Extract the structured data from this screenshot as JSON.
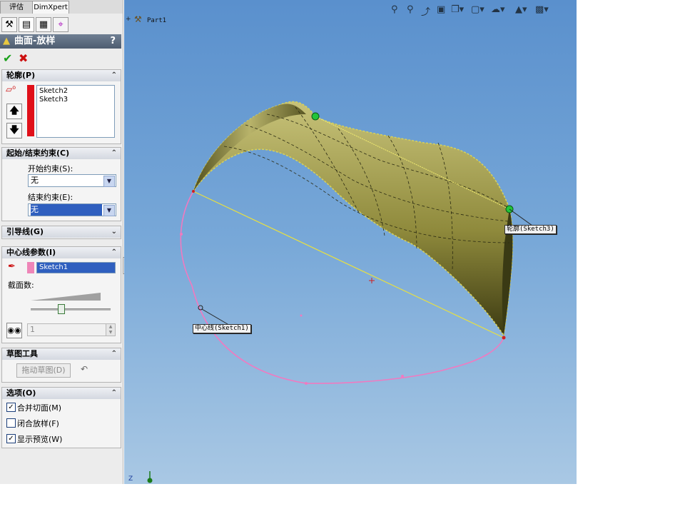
{
  "tabs": [
    "评估",
    "DimXpert"
  ],
  "manager_icons": [
    "feature-manager-icon",
    "property-manager-icon",
    "configuration-manager-icon",
    "dimxpert-manager-icon"
  ],
  "property_manager": {
    "title": "曲面-放样",
    "help": "?",
    "ok": "✔",
    "cancel": "✖"
  },
  "profiles": {
    "header": "轮廓(P)",
    "items": [
      "Sketch2",
      "Sketch3"
    ],
    "color": "#e0101a"
  },
  "constraints": {
    "header": "起始/结束约束(C)",
    "start_label": "开始约束(S):",
    "start_value": "无",
    "end_label": "结束约束(E):",
    "end_value": "无"
  },
  "guides": {
    "header": "引导线(G)"
  },
  "centerline": {
    "header": "中心线参数(I)",
    "value": "Sketch1",
    "color": "#ee86b8",
    "sections_label": "截面数:",
    "sections_value": "1"
  },
  "sketch_tools": {
    "header": "草图工具",
    "drag_button": "拖动草图(D)"
  },
  "options": {
    "header": "选项(O)",
    "items": [
      {
        "label": "合并切面(M)",
        "checked": true
      },
      {
        "label": "闭合放样(F)",
        "checked": false
      },
      {
        "label": "显示预览(W)",
        "checked": true
      }
    ]
  },
  "viewport": {
    "tree_label": "Part1",
    "callout_profile": "轮廓(Sketch3)",
    "callout_center": "中心线(Sketch1)",
    "axis_label": "Z"
  }
}
